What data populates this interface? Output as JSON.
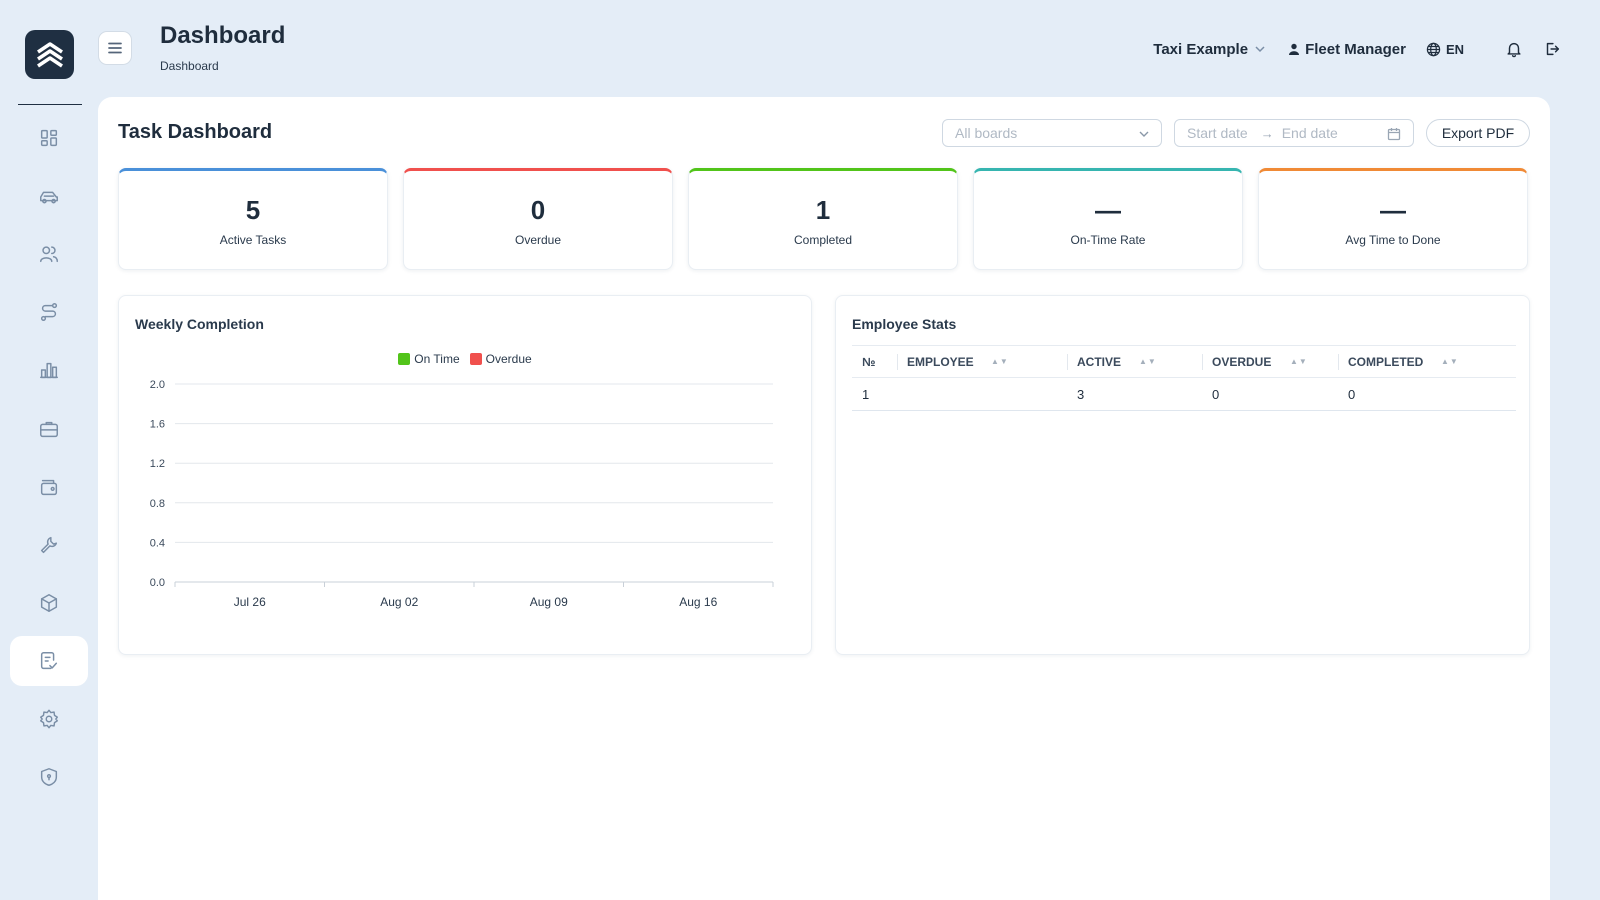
{
  "header": {
    "title": "Dashboard",
    "breadcrumb": "Dashboard",
    "company": "Taxi Example",
    "user": "Fleet Manager",
    "language": "EN"
  },
  "sidebar": {
    "items": [
      {
        "icon": "dashboard-icon",
        "active": false
      },
      {
        "icon": "car-icon",
        "active": false
      },
      {
        "icon": "users-icon",
        "active": false
      },
      {
        "icon": "route-icon",
        "active": false
      },
      {
        "icon": "bar-chart-icon",
        "active": false
      },
      {
        "icon": "briefcase-icon",
        "active": false
      },
      {
        "icon": "wallet-icon",
        "active": false
      },
      {
        "icon": "wrench-icon",
        "active": false
      },
      {
        "icon": "package-icon",
        "active": false
      },
      {
        "icon": "task-checklist-icon",
        "active": true
      },
      {
        "icon": "gear-icon",
        "active": false
      },
      {
        "icon": "shield-icon",
        "active": false
      }
    ]
  },
  "main": {
    "title": "Task Dashboard",
    "boards_placeholder": "All boards",
    "start_date_placeholder": "Start date",
    "end_date_placeholder": "End date",
    "export_label": "Export PDF"
  },
  "kpis": [
    {
      "value": "5",
      "label": "Active Tasks",
      "color": "#4a90d9"
    },
    {
      "value": "0",
      "label": "Overdue",
      "color": "#f0504d"
    },
    {
      "value": "1",
      "label": "Completed",
      "color": "#52c41a"
    },
    {
      "value": "—",
      "label": "On-Time Rate",
      "color": "#36b5b0"
    },
    {
      "value": "—",
      "label": "Avg Time to Done",
      "color": "#f08a36"
    }
  ],
  "weekly": {
    "title": "Weekly Completion"
  },
  "chart_data": {
    "type": "bar",
    "title": "Weekly Completion",
    "categories": [
      "Jul 26",
      "Aug 02",
      "Aug 09",
      "Aug 16"
    ],
    "series": [
      {
        "name": "On Time",
        "color": "#52c41a",
        "values": [
          0,
          0,
          0,
          0
        ]
      },
      {
        "name": "Overdue",
        "color": "#f0504d",
        "values": [
          0,
          0,
          0,
          0
        ]
      }
    ],
    "ylim": [
      0,
      2.0
    ],
    "yticks": [
      "2.0",
      "1.6",
      "1.2",
      "0.8",
      "0.4",
      "0.0"
    ],
    "grid": true,
    "legend": "top-center"
  },
  "employee_stats": {
    "title": "Employee Stats",
    "columns": [
      "№",
      "EMPLOYEE",
      "ACTIVE",
      "OVERDUE",
      "COMPLETED"
    ],
    "rows": [
      {
        "num": "1",
        "employee": "",
        "active": "3",
        "overdue": "0",
        "completed": "0"
      }
    ]
  }
}
